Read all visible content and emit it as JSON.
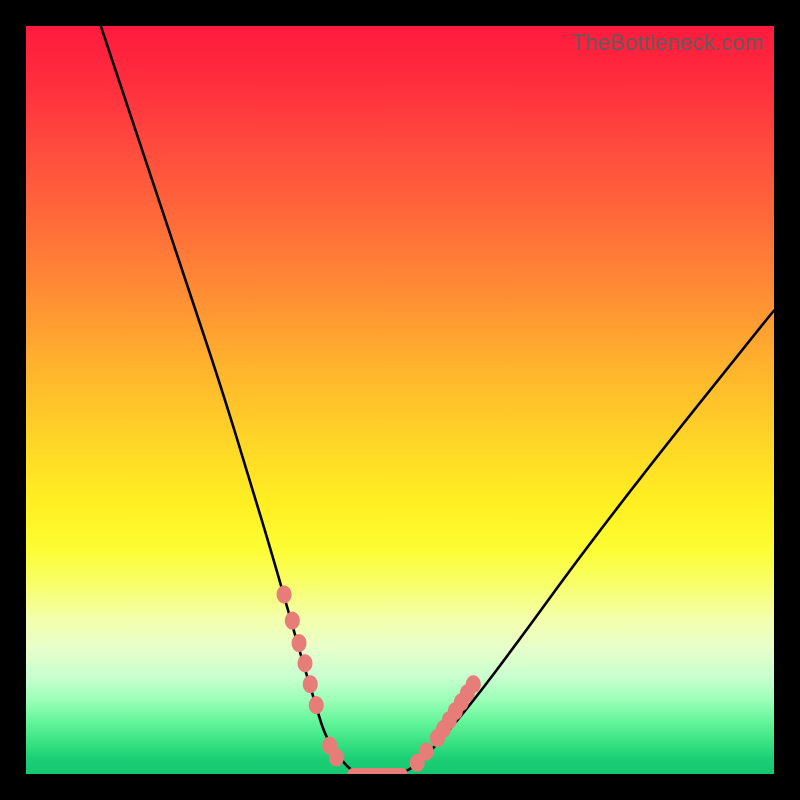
{
  "watermark": "TheBottleneck.com",
  "chart_data": {
    "type": "line",
    "title": "",
    "xlabel": "",
    "ylabel": "",
    "xlim": [
      0,
      100
    ],
    "ylim": [
      0,
      100
    ],
    "curve_note": "V-shaped bottleneck curve; y is % penalty (top=100, bottom=0). Approximate points read from plot.",
    "series": [
      {
        "name": "bottleneck-curve",
        "x": [
          10,
          14,
          18,
          22,
          26,
          30,
          33,
          35,
          37,
          38.5,
          40,
          42,
          44,
          46,
          48,
          50,
          52,
          55,
          60,
          66,
          74,
          84,
          96,
          100
        ],
        "y": [
          100,
          88,
          76,
          64,
          52,
          39,
          29,
          22,
          15,
          10,
          5,
          2,
          0,
          0,
          0,
          0,
          1,
          4,
          10,
          18,
          29,
          42,
          57,
          62
        ]
      }
    ],
    "markers_left": [
      [
        34.5,
        24
      ],
      [
        35.6,
        20.5
      ],
      [
        36.5,
        17.5
      ],
      [
        37.3,
        14.8
      ],
      [
        38,
        12
      ],
      [
        38.8,
        9.2
      ],
      [
        40.6,
        3.8
      ],
      [
        41.5,
        2.2
      ]
    ],
    "markers_right": [
      [
        52.3,
        1.5
      ],
      [
        53.5,
        3
      ],
      [
        55,
        4.8
      ],
      [
        55.8,
        6
      ],
      [
        56.6,
        7.2
      ],
      [
        57.4,
        8.4
      ],
      [
        58.2,
        9.6
      ],
      [
        59,
        10.8
      ],
      [
        59.8,
        12
      ]
    ],
    "flat_segment": {
      "x0": 43,
      "x1": 51,
      "y": 0
    },
    "background_gradient": {
      "top": "#ff1a3e",
      "mid": "#fff022",
      "bottom": "#15c870"
    },
    "marker_color": "#e77d78",
    "curve_color": "#000000"
  }
}
